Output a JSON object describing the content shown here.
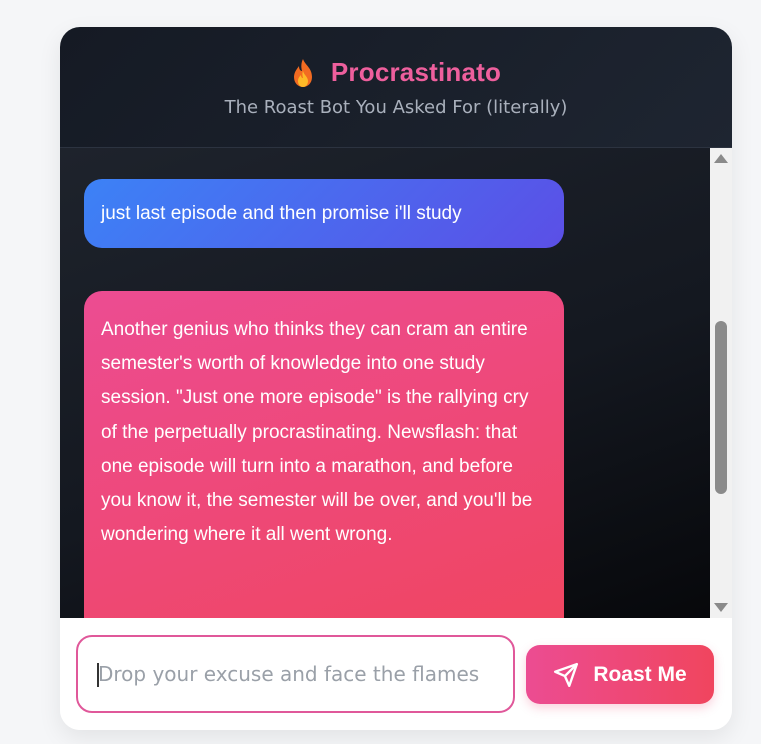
{
  "header": {
    "icon": "fire-icon",
    "title": "Procrastinato",
    "subtitle": "The Roast Bot You Asked For (literally)"
  },
  "messages": [
    {
      "role": "user",
      "text": "just last episode and then promise i'll study"
    },
    {
      "role": "bot",
      "text": "Another genius who thinks they can cram an entire semester's worth of knowledge into one study session. \"Just one more episode\" is the rallying cry of the perpetually procrastinating. Newsflash: that one episode will turn into a marathon, and before you know it, the semester will be over, and you'll be wondering where it all went wrong."
    }
  ],
  "input": {
    "value": "",
    "placeholder": "Drop your excuse and face the flames"
  },
  "send_button": {
    "icon": "send-icon",
    "label": "Roast Me"
  },
  "colors": {
    "accent_pink": "#ec4c92",
    "accent_red": "#f0455e",
    "user_bubble_start": "#3c82f6",
    "user_bubble_end": "#5b4fe6",
    "header_bg": "#151a24",
    "title_color": "#ee5f9d"
  }
}
